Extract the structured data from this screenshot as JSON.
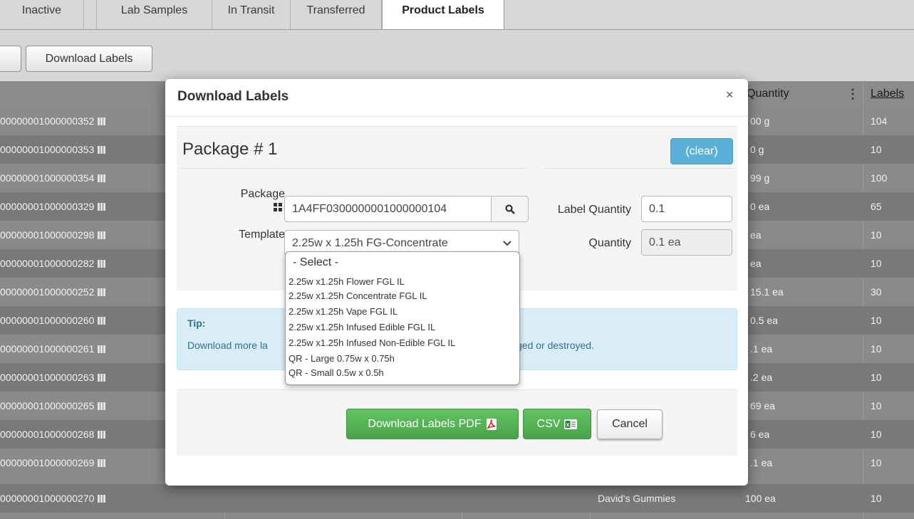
{
  "tabs": [
    {
      "label": "Inactive"
    },
    {
      "label": "Lab Samples"
    },
    {
      "label": "In Transit"
    },
    {
      "label": "Transferred"
    },
    {
      "label": "Product Labels"
    }
  ],
  "toolbar": {
    "download_labels": "Download Labels"
  },
  "grid": {
    "headers": {
      "quantity": "Quantity",
      "labels": "Labels"
    },
    "rows": [
      {
        "tag": "00000001000000352",
        "qty": "00 g",
        "labels": "104"
      },
      {
        "tag": "00000001000000353",
        "qty": "0 g",
        "labels": "10"
      },
      {
        "tag": "00000001000000354",
        "qty": "99 g",
        "labels": "100"
      },
      {
        "tag": "00000001000000329",
        "qty": "0 ea",
        "labels": "65"
      },
      {
        "tag": "00000001000000298",
        "qty": "ea",
        "labels": "10"
      },
      {
        "tag": "00000001000000282",
        "qty": "ea",
        "labels": "10"
      },
      {
        "tag": "00000001000000252",
        "qty": "15.1 ea",
        "labels": "30"
      },
      {
        "tag": "00000001000000260",
        "qty": "0.5 ea",
        "labels": "10"
      },
      {
        "tag": "00000001000000261",
        "qty": ".1 ea",
        "labels": "10"
      },
      {
        "tag": "00000001000000263",
        "qty": ".2 ea",
        "labels": "10"
      },
      {
        "tag": "00000001000000265",
        "qty": "69 ea",
        "labels": "10"
      },
      {
        "tag": "00000001000000268",
        "qty": "6 ea",
        "labels": "10"
      },
      {
        "tag": "00000001000000269",
        "qty": ".1 ea",
        "labels": "10"
      },
      {
        "tag": "00000001000000270",
        "qty": "100 ea",
        "labels": "10",
        "item": "David's Gummies"
      }
    ]
  },
  "modal": {
    "title": "Download Labels",
    "close": "×",
    "package_heading": "Package # 1",
    "clear": "(clear)",
    "package_label": "Package",
    "package_value": "1A4FF0300000001000000104",
    "template_label": "Template",
    "template_value": "2.25w x 1.25h FG-Concentrate",
    "label_quantity_label": "Label Quantity",
    "label_quantity_value": "0.1",
    "quantity_label": "Quantity",
    "quantity_value": "0.1 ea",
    "tip_heading": "Tip:",
    "tip_text_start": "Download more la",
    "tip_text_end": "ged or destroyed.",
    "download_pdf": "Download Labels PDF",
    "csv": "CSV",
    "cancel": "Cancel"
  },
  "template_dropdown": {
    "options": [
      "- Select -",
      "2.25w x1.25h Flower FGL IL",
      "2.25w x1.25h Concentrate FGL IL",
      "2.25w x1.25h Vape FGL IL",
      "2.25w x1.25h Infused Edible FGL IL",
      "2.25w x1.25h Infused Non-Edible FGL IL",
      "QR - Large 0.75w x 0.75h",
      "QR - Small 0.5w x 0.5h"
    ]
  },
  "colors": {
    "overlay": "#8a8a8a",
    "clear_button": "#5bb0d7",
    "green_button": "#4cae4c",
    "tip_bg": "#d9edf7",
    "tip_text": "#31708f"
  }
}
